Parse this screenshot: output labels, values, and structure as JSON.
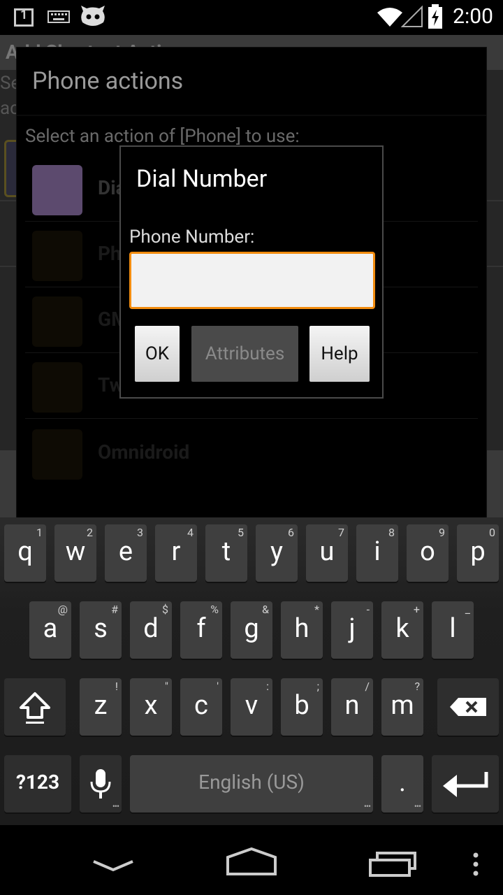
{
  "status_bar": {
    "notification_count": "1",
    "time": "2:00",
    "icons": [
      "notification-icon",
      "keyboard-icon",
      "cyanogen-icon",
      "wifi-icon",
      "signal-icon",
      "battery-icon"
    ]
  },
  "background_app": {
    "title": "Add Shortcut Actions",
    "line1": "Se",
    "line2": "ac"
  },
  "outer_dialog": {
    "title": "Phone actions",
    "prompt": "Select an action of [Phone] to use:",
    "actions": [
      "Dial Number",
      "Ph",
      "GM",
      "Tw",
      "Omnidroid"
    ]
  },
  "inner_dialog": {
    "title": "Dial Number",
    "field_label": "Phone Number:",
    "field_value": "",
    "ok_label": "OK",
    "attributes_label": "Attributes",
    "help_label": "Help"
  },
  "keyboard": {
    "row1": [
      [
        "q",
        "1"
      ],
      [
        "w",
        "2"
      ],
      [
        "e",
        "3"
      ],
      [
        "r",
        "4"
      ],
      [
        "t",
        "5"
      ],
      [
        "y",
        "6"
      ],
      [
        "u",
        "7"
      ],
      [
        "i",
        "8"
      ],
      [
        "o",
        "9"
      ],
      [
        "p",
        "0"
      ]
    ],
    "row2": [
      [
        "a",
        "@"
      ],
      [
        "s",
        "#"
      ],
      [
        "d",
        "$"
      ],
      [
        "f",
        "%"
      ],
      [
        "g",
        "&"
      ],
      [
        "h",
        "*"
      ],
      [
        "j",
        "-"
      ],
      [
        "k",
        "+"
      ],
      [
        "l",
        "_"
      ]
    ],
    "row3": [
      [
        "z",
        "!"
      ],
      [
        "x",
        "\""
      ],
      [
        "c",
        "'"
      ],
      [
        "v",
        ":"
      ],
      [
        "b",
        ";"
      ],
      [
        "n",
        "/"
      ],
      [
        "m",
        "?"
      ]
    ],
    "symbols_label": "?123",
    "space_label": "English (US)",
    "period_label": "."
  },
  "colors": {
    "accent_orange": "#f28c0f",
    "purple_icon": "#5c4a6e"
  }
}
